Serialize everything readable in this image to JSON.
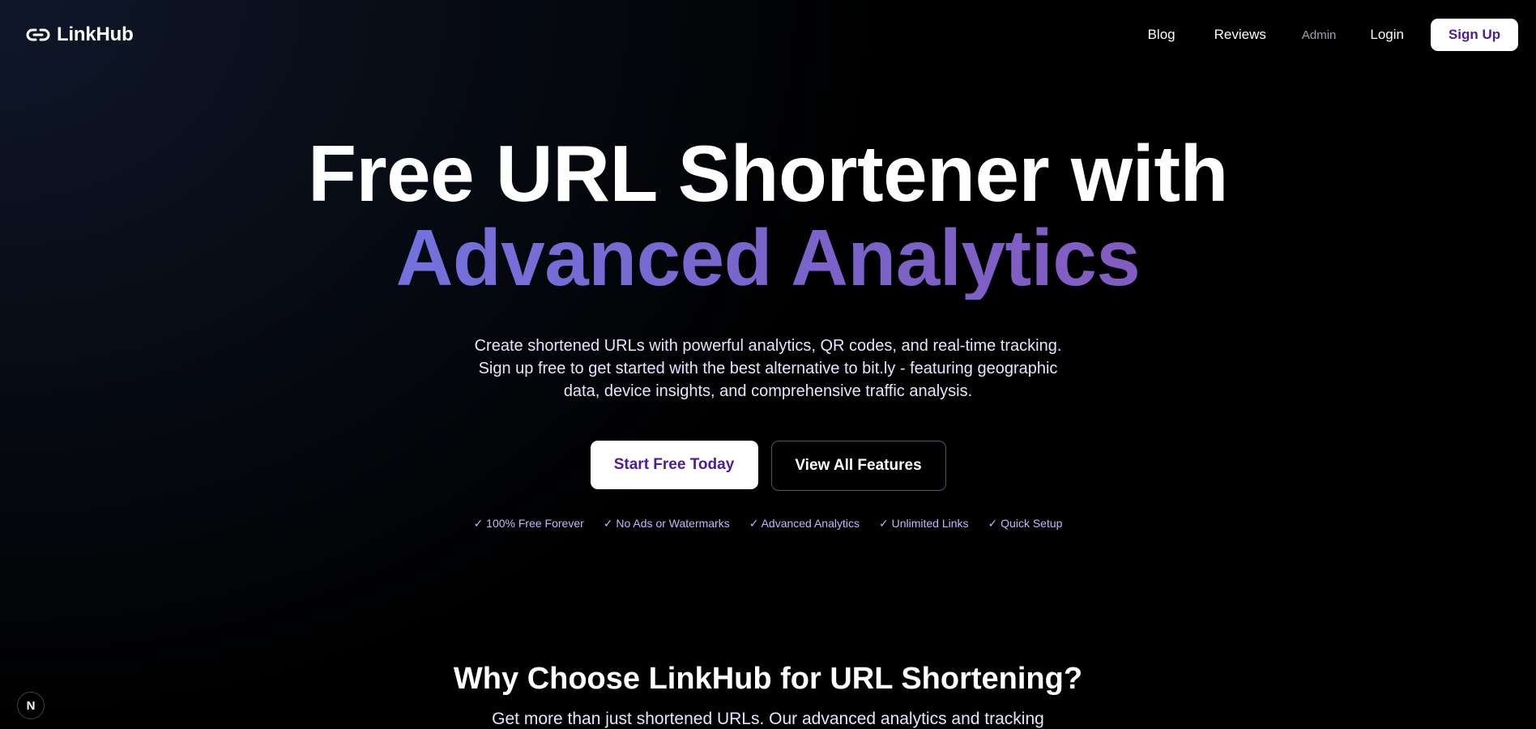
{
  "nav": {
    "brand": {
      "name": "LinkHub",
      "icon": "link-icon"
    },
    "links": {
      "blog": "Blog",
      "reviews": "Reviews",
      "admin": "Admin",
      "login": "Login"
    },
    "signup_label": "Sign Up"
  },
  "hero": {
    "title_line1": "Free URL Shortener with",
    "title_line2": "Advanced Analytics",
    "description": "Create shortened URLs with powerful analytics, QR codes, and real-time tracking. Sign up free to get started with the best alternative to bit.ly - featuring geographic data, device insights, and comprehensive traffic analysis.",
    "cta_primary": "Start Free Today",
    "cta_secondary": "View All Features",
    "features": [
      "✓ 100% Free Forever",
      "✓ No Ads or Watermarks",
      "✓ Advanced Analytics",
      "✓ Unlimited Links",
      "✓ Quick Setup"
    ]
  },
  "why": {
    "title": "Why Choose LinkHub for URL Shortening?",
    "description": "Get more than just shortened URLs. Our advanced analytics and tracking"
  },
  "dev_badge": {
    "letter": "N",
    "icon": "nextjs-icon"
  },
  "colors": {
    "background": "#000000",
    "accent_purple": "#4c1d95",
    "gradient_start": "#6d7ff0",
    "gradient_end": "#8a55b8",
    "feature_text": "#c4b5fd",
    "admin_text": "#9ca3af"
  }
}
